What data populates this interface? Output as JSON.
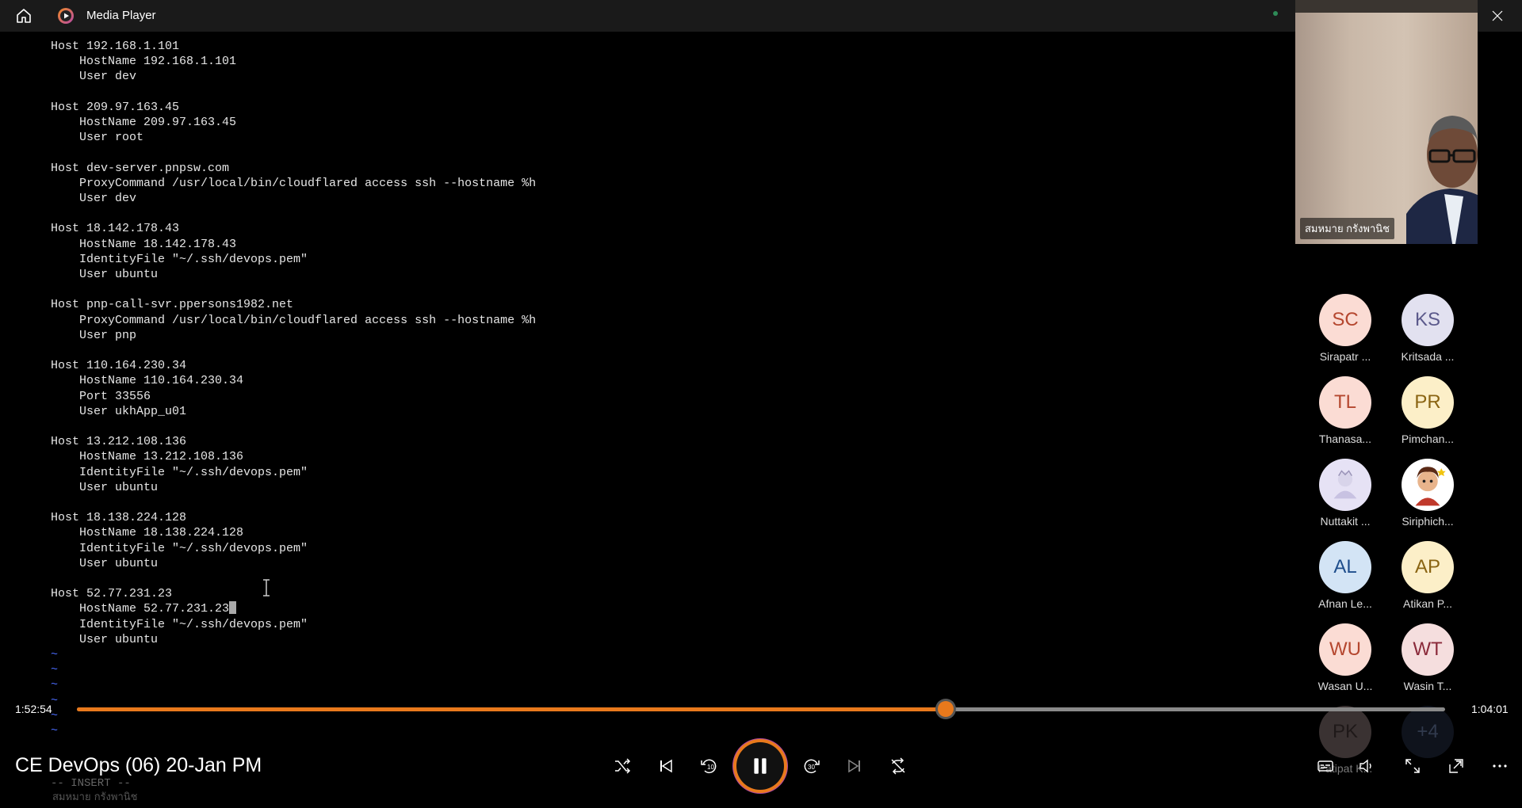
{
  "window": {
    "title": "Media Player"
  },
  "terminal": {
    "lines": [
      "Host 192.168.1.101",
      "    HostName 192.168.1.101",
      "    User dev",
      "",
      "Host 209.97.163.45",
      "    HostName 209.97.163.45",
      "    User root",
      "",
      "Host dev-server.pnpsw.com",
      "    ProxyCommand /usr/local/bin/cloudflared access ssh --hostname %h",
      "    User dev",
      "",
      "Host 18.142.178.43",
      "    HostName 18.142.178.43",
      "    IdentityFile \"~/.ssh/devops.pem\"",
      "    User ubuntu",
      "",
      "Host pnp-call-svr.ppersons1982.net",
      "    ProxyCommand /usr/local/bin/cloudflared access ssh --hostname %h",
      "    User pnp",
      "",
      "Host 110.164.230.34",
      "    HostName 110.164.230.34",
      "    Port 33556",
      "    User ukhApp_u01",
      "",
      "Host 13.212.108.136",
      "    HostName 13.212.108.136",
      "    IdentityFile \"~/.ssh/devops.pem\"",
      "    User ubuntu",
      "",
      "Host 18.138.224.128",
      "    HostName 18.138.224.128",
      "    IdentityFile \"~/.ssh/devops.pem\"",
      "    User ubuntu",
      "",
      "Host 52.77.231.23",
      "    HostName 52.77.231.23",
      "    IdentityFile \"~/.ssh/devops.pem\"",
      "    User ubuntu"
    ],
    "tilde": "~",
    "mode_line": "-- INSERT --",
    "speaker_caption": "สมหมาย กรังพานิช"
  },
  "video": {
    "speaker_name": "สมหมาย กรังพานิช"
  },
  "participants": [
    {
      "initials": "SC",
      "name": "Sirapatr ...",
      "bg": "#fbdcd4",
      "fg": "#b5472f"
    },
    {
      "initials": "KS",
      "name": "Kritsada ...",
      "bg": "#e2e1f0",
      "fg": "#5c5a8c"
    },
    {
      "initials": "TL",
      "name": "Thanasa...",
      "bg": "#fbdcd4",
      "fg": "#b5472f"
    },
    {
      "initials": "PR",
      "name": "Pimchan...",
      "bg": "#fcefc8",
      "fg": "#8a6412"
    },
    {
      "initials": "",
      "name": "Nuttakit ...",
      "bg": "#e6e2f5",
      "fg": "#555"
    },
    {
      "initials": "",
      "name": "Siriphich...",
      "bg": "#ffffff",
      "fg": "#555"
    },
    {
      "initials": "AL",
      "name": "Afnan Le...",
      "bg": "#d3e4f5",
      "fg": "#1f4e8c"
    },
    {
      "initials": "AP",
      "name": "Atikan P...",
      "bg": "#fcefc8",
      "fg": "#8a6412"
    },
    {
      "initials": "WU",
      "name": "Wasan U...",
      "bg": "#fbdcd4",
      "fg": "#b5472f"
    },
    {
      "initials": "WT",
      "name": "Wasin T...",
      "bg": "#f5dede",
      "fg": "#8a2a3a"
    },
    {
      "initials": "PK",
      "name": "Patipat K...",
      "bg": "#6a5c5c",
      "fg": "#3a2e2e"
    },
    {
      "initials": "+4",
      "name": "",
      "bg": "#1c2333",
      "fg": "#5a6a8c"
    }
  ],
  "player": {
    "elapsed": "1:52:54",
    "remaining": "1:04:01",
    "progress_fraction": 0.635,
    "media_title": "CE DevOps (06) 20-Jan PM",
    "accent": "#e8791c"
  },
  "icons": {
    "home": "home-icon",
    "app": "media-player-logo-icon",
    "minimize": "minimize-icon",
    "restore": "restore-icon",
    "close": "close-icon",
    "shuffle": "shuffle-icon",
    "previous": "previous-icon",
    "back10": "skip-back-10-icon",
    "pause": "pause-icon",
    "forward30": "skip-forward-30-icon",
    "next": "next-icon",
    "repeat": "repeat-icon",
    "captions": "captions-icon",
    "volume": "volume-icon",
    "fullscreen": "fullscreen-icon",
    "miniplayer": "miniplayer-icon",
    "more": "more-icon"
  }
}
